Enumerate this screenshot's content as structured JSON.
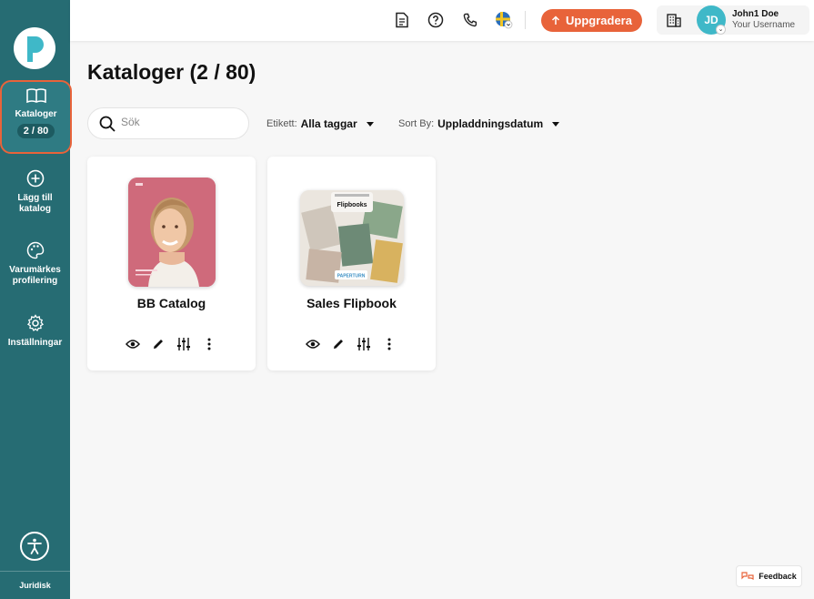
{
  "sidebar": {
    "items": [
      {
        "label": "Kataloger",
        "badge": "2 / 80",
        "icon": "open-book-icon"
      },
      {
        "label": "Lägg till katalog",
        "icon": "plus-circle-icon"
      },
      {
        "label": "Varumärkes profilering",
        "icon": "palette-icon"
      },
      {
        "label": "Inställningar",
        "icon": "gear-icon"
      }
    ],
    "footer_label": "Juridisk"
  },
  "header": {
    "upgrade_label": "Uppgradera",
    "user_name": "John1 Doe",
    "user_sub": "Your Username",
    "avatar_initials": "JD"
  },
  "main": {
    "title": "Kataloger (2 / 80)",
    "search_placeholder": "Sök",
    "filter_label": "Etikett:",
    "filter_value": "Alla taggar",
    "sort_label": "Sort By:",
    "sort_value": "Uppladdningsdatum"
  },
  "catalogs": [
    {
      "title": "BB Catalog"
    },
    {
      "title": "Sales Flipbook",
      "cover_text": "Flipbooks",
      "cover_brand": "PAPERTURN"
    }
  ],
  "feedback_label": "Feedback",
  "colors": {
    "sidebar": "#266c73",
    "accent": "#e8633a",
    "avatar": "#3fb8c8"
  }
}
